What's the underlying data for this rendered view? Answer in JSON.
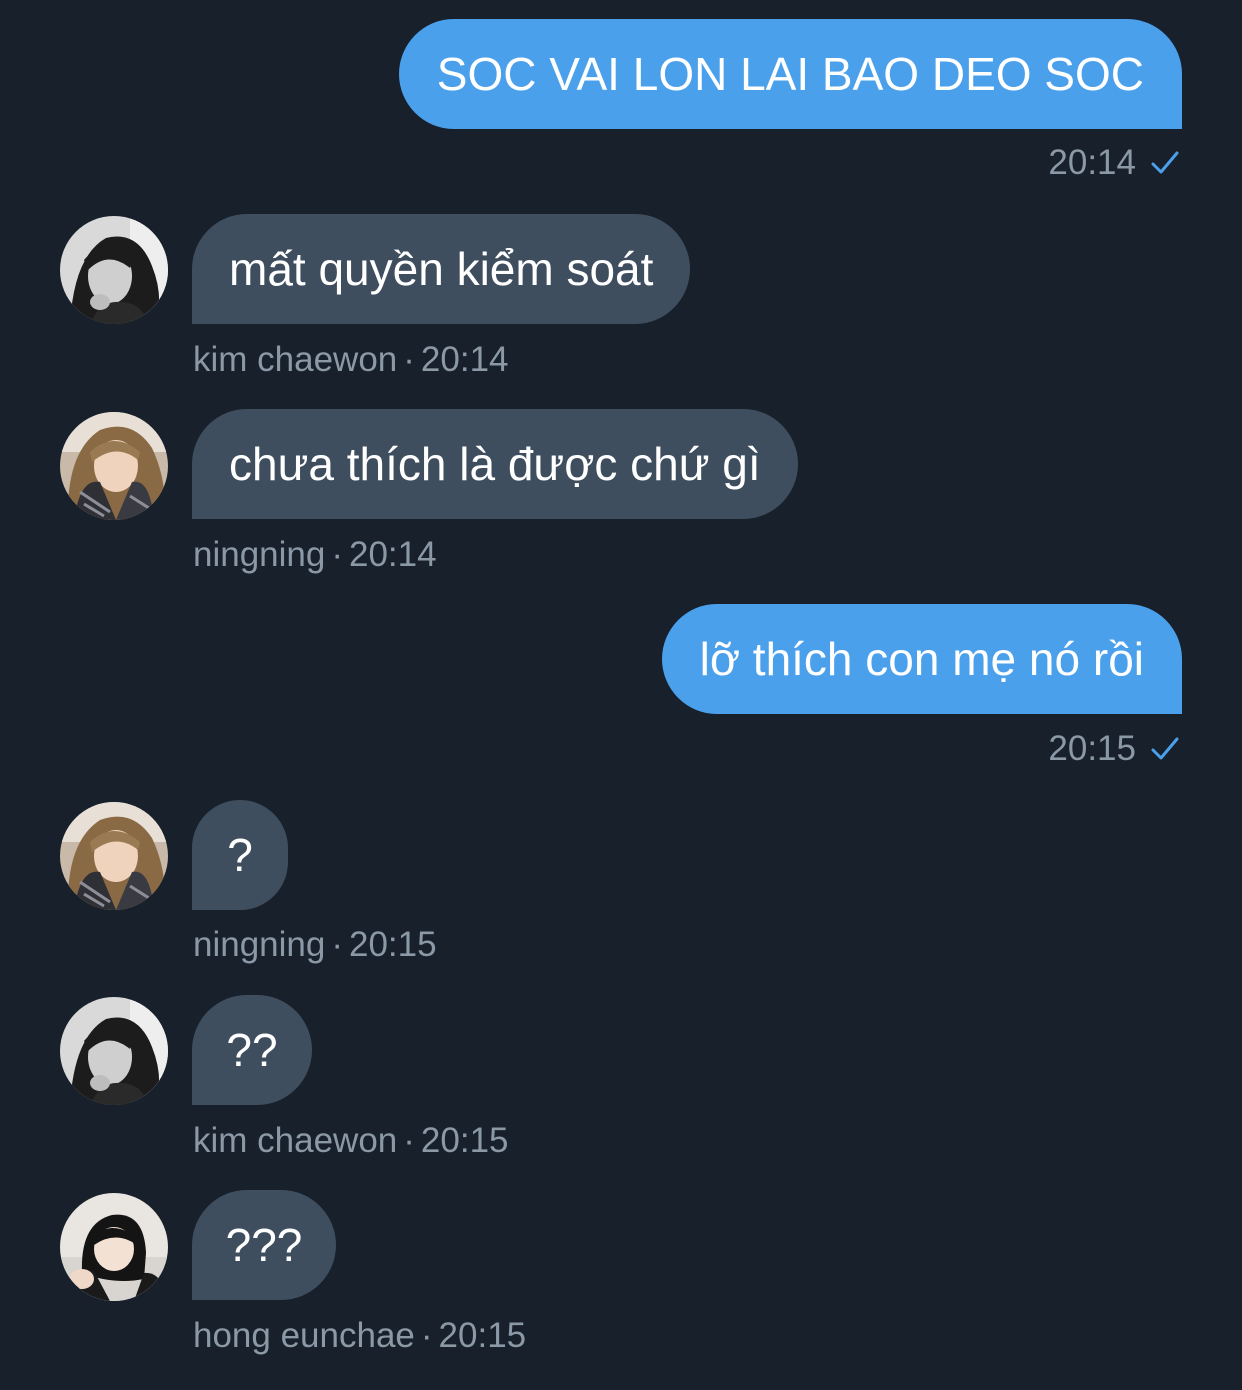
{
  "messages": [
    {
      "direction": "outgoing",
      "text": "SOC VAI LON LAI BAO DEO SOC",
      "time": "20:14",
      "status_icon": "checkmark-icon"
    },
    {
      "direction": "incoming",
      "sender": "kim chaewon",
      "text": "mất quyền kiểm soát",
      "time": "20:14",
      "separator": "·",
      "avatar": "avatar-kim-chaewon"
    },
    {
      "direction": "incoming",
      "sender": "ningning",
      "text": "chưa thích là được chứ gì",
      "time": "20:14",
      "separator": "·",
      "avatar": "avatar-ningning"
    },
    {
      "direction": "outgoing",
      "text": "lỡ thích con mẹ nó rồi",
      "time": "20:15",
      "status_icon": "checkmark-icon"
    },
    {
      "direction": "incoming",
      "sender": "ningning",
      "text": "?",
      "time": "20:15",
      "separator": "·",
      "avatar": "avatar-ningning"
    },
    {
      "direction": "incoming",
      "sender": "kim chaewon",
      "text": "??",
      "time": "20:15",
      "separator": "·",
      "avatar": "avatar-kim-chaewon"
    },
    {
      "direction": "incoming",
      "sender": "hong eunchae",
      "text": "???",
      "time": "20:15",
      "separator": "·",
      "avatar": "avatar-hong-eunchae"
    }
  ],
  "colors": {
    "background": "#18202b",
    "outgoing_bubble": "#4ba0ec",
    "incoming_bubble": "#3f4e5f",
    "meta_text": "#8b98a6",
    "check": "#4ba0ec"
  }
}
